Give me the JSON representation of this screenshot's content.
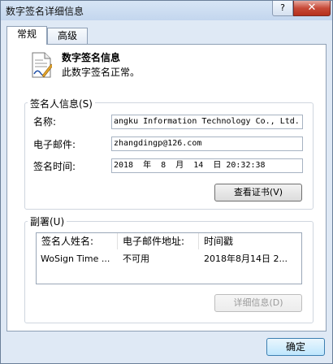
{
  "window": {
    "title": "数字签名详细信息",
    "help": "?",
    "close": "✕"
  },
  "tabs": [
    "常规",
    "高级"
  ],
  "header": {
    "title": "数字签名信息",
    "subtitle": "此数字签名正常。"
  },
  "signer": {
    "group_label": "签名人信息(S)",
    "name_label": "名称:",
    "name_value": "angku Information Technology Co., Ltd.",
    "email_label": "电子邮件:",
    "email_value": "zhangdingp@126.com",
    "time_label": "签名时间:",
    "time_value": "2018  年  8  月  14  日 20:32:38",
    "view_cert": "查看证书(V)"
  },
  "countersign": {
    "group_label": "副署(U)",
    "columns": [
      "签名人姓名:",
      "电子邮件地址:",
      "时间戳"
    ],
    "rows": [
      {
        "name": "WoSign Time ...",
        "email": "不可用",
        "timestamp": "2018年8月14日 2..."
      }
    ],
    "details": "详细信息(D)"
  },
  "ok_button": "确定"
}
